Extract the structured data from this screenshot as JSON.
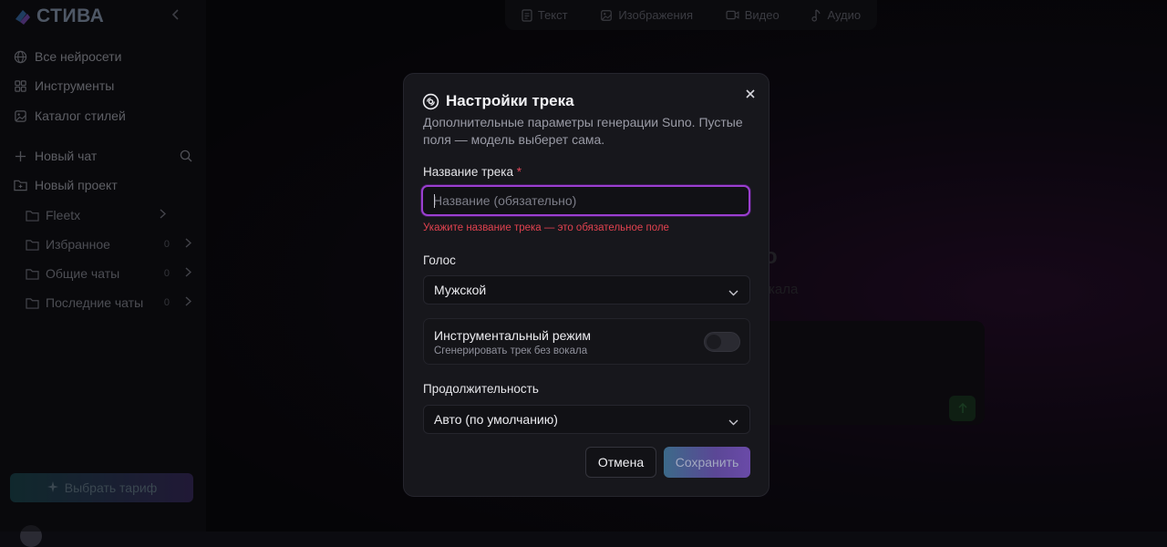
{
  "app": {
    "logo_text": "СТИВА"
  },
  "sidebar": {
    "nav": [
      {
        "label": "Все нейросети",
        "icon": "globe-icon"
      },
      {
        "label": "Инструменты",
        "icon": "grid-icon"
      },
      {
        "label": "Каталог стилей",
        "icon": "image-icon"
      }
    ],
    "new_chat_label": "Новый чат",
    "new_project_label": "Новый проект",
    "folders": [
      {
        "label": "Fleetx",
        "count": ""
      },
      {
        "label": "Избранное",
        "count": "0"
      },
      {
        "label": "Общие чаты",
        "count": "0"
      },
      {
        "label": "Последние чаты",
        "count": "0"
      }
    ],
    "tariff_label": "Выбрать тариф"
  },
  "top_tabs": [
    {
      "label": "Текст",
      "icon": "document-icon"
    },
    {
      "label": "Изображения",
      "icon": "image-icon"
    },
    {
      "label": "Видео",
      "icon": "video-icon"
    },
    {
      "label": "Аудио",
      "icon": "music-note-icon"
    }
  ],
  "background": {
    "title_fragment": "о",
    "subtitle_fragment": "кала"
  },
  "modal": {
    "title": "Настройки трека",
    "description": "Дополнительные параметры генерации Suno. Пустые поля — модель выберет сама.",
    "track_name": {
      "label": "Название трека",
      "required_mark": "*",
      "placeholder": "Название (обязательно)",
      "value": "",
      "error": "Укажите название трека — это обязательное поле"
    },
    "voice": {
      "label": "Голос",
      "selected": "Мужской"
    },
    "instrumental": {
      "title": "Инструментальный режим",
      "subtitle": "Сгенерировать трек без вокала",
      "enabled": false
    },
    "duration": {
      "label": "Продолжительность",
      "selected": "Авто (по умолчанию)"
    },
    "cancel_label": "Отмена",
    "save_label": "Сохранить"
  },
  "colors": {
    "accent_border": "#9b3fd0",
    "error": "#e0424f",
    "save_gradient_start": "#3c6a89",
    "save_gradient_end": "#6a4aa8"
  }
}
